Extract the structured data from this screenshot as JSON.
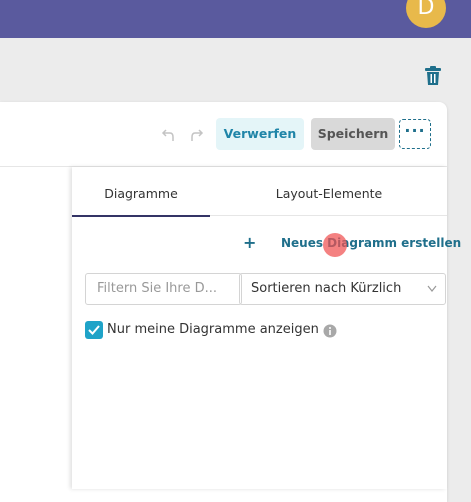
{
  "header": {
    "avatar_initial": "D",
    "accent": "#5a5a9e"
  },
  "toolbar": {
    "discard_label": "Verwerfen",
    "save_label": "Speichern",
    "more_label": "···"
  },
  "tabs": [
    {
      "label": "Diagramme",
      "active": true
    },
    {
      "label": "Layout-Elemente",
      "active": false
    }
  ],
  "panel": {
    "new_chart_plus": "+",
    "new_chart_label": "Neues Diagramm erstellen",
    "filter_placeholder": "Filtern Sie Ihre D...",
    "sort_value": "Sortieren nach Kürzlich",
    "only_mine_label": "Nur meine Diagramme anzeigen",
    "only_mine_checked": true
  },
  "icons": [
    "trash-icon",
    "undo-icon",
    "redo-icon",
    "chevron-down-icon",
    "check-icon",
    "info-icon"
  ]
}
